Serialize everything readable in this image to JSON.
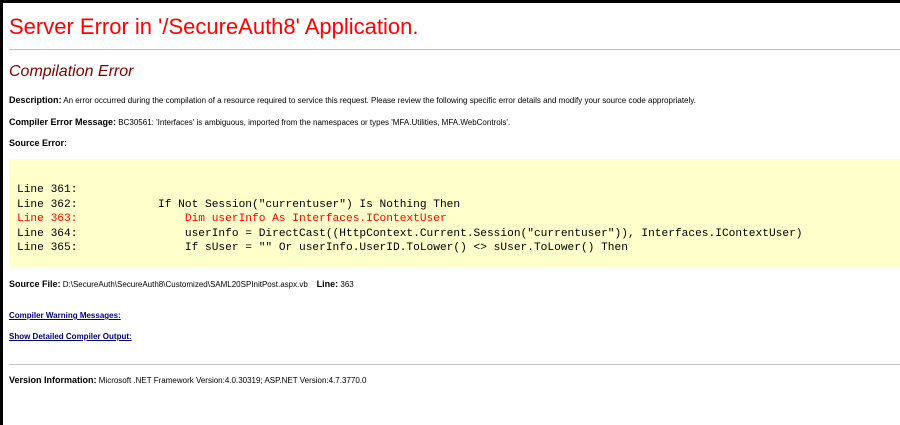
{
  "page": {
    "title": "Server Error in '/SecureAuth8' Application.",
    "subtitle": "Compilation Error"
  },
  "description": {
    "label": "Description:",
    "text": "An error occurred during the compilation of a resource required to service this request. Please review the following specific error details and modify your source code appropriately."
  },
  "compiler_error": {
    "label": "Compiler Error Message:",
    "text": "BC30561: 'Interfaces' is ambiguous, imported from the namespaces or types 'MFA.Utilities, MFA.WebControls'."
  },
  "source_error": {
    "label": "Source Error:",
    "lines": [
      {
        "label": "Line 361:",
        "code": ""
      },
      {
        "label": "Line 362:",
        "code": "            If Not Session(\"currentuser\") Is Nothing Then"
      },
      {
        "label": "Line 363:",
        "code": "                Dim userInfo As Interfaces.IContextUser"
      },
      {
        "label": "Line 364:",
        "code": "                userInfo = DirectCast((HttpContext.Current.Session(\"currentuser\")), Interfaces.IContextUser)"
      },
      {
        "label": "Line 365:",
        "code": "                If sUser = \"\" Or userInfo.UserID.ToLower() <> sUser.ToLower() Then"
      }
    ]
  },
  "source_file": {
    "label": "Source File:",
    "path": "D:\\SecureAuth\\SecureAuth8\\Customized\\SAML20SPInitPost.aspx.vb",
    "line_label": "Line:",
    "line_number": "363"
  },
  "links": {
    "warnings": "Compiler Warning Messages:",
    "detailed": "Show Detailed Compiler Output:"
  },
  "version": {
    "label": "Version Information:",
    "text": "Microsoft .NET Framework Version:4.0.30319; ASP.NET Version:4.7.3770.0"
  },
  "colors": {
    "title": "#ff0000",
    "subtitle": "#800000",
    "error_line": "#ff0000",
    "source_bg": "#ffffcc",
    "link": "#000080"
  }
}
